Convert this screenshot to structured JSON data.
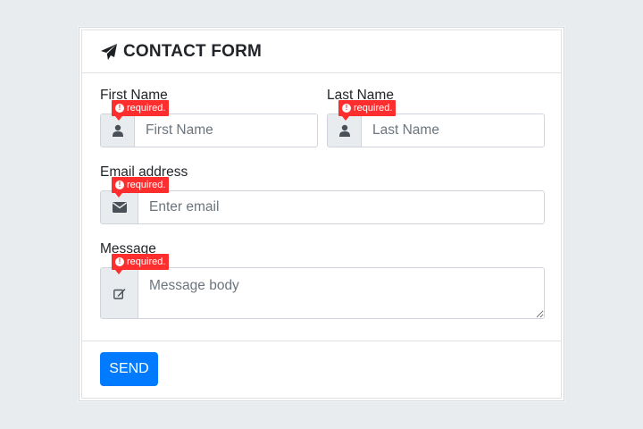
{
  "form": {
    "title": "CONTACT FORM",
    "title_icon": "paper-plane-icon"
  },
  "fields": {
    "first_name": {
      "label": "First Name",
      "placeholder": "First Name",
      "value": "",
      "icon": "user-icon",
      "error": "required."
    },
    "last_name": {
      "label": "Last Name",
      "placeholder": "Last Name",
      "value": "",
      "icon": "user-icon",
      "error": "required."
    },
    "email": {
      "label": "Email address",
      "placeholder": "Enter email",
      "value": "",
      "icon": "envelope-icon",
      "error": "required."
    },
    "message": {
      "label": "Message",
      "placeholder": "Message body",
      "value": "",
      "icon": "edit-icon",
      "error": "required."
    }
  },
  "actions": {
    "send_label": "SEND"
  },
  "colors": {
    "accent": "#007bff",
    "error": "#ff2e2e",
    "background": "#e9ecef"
  }
}
